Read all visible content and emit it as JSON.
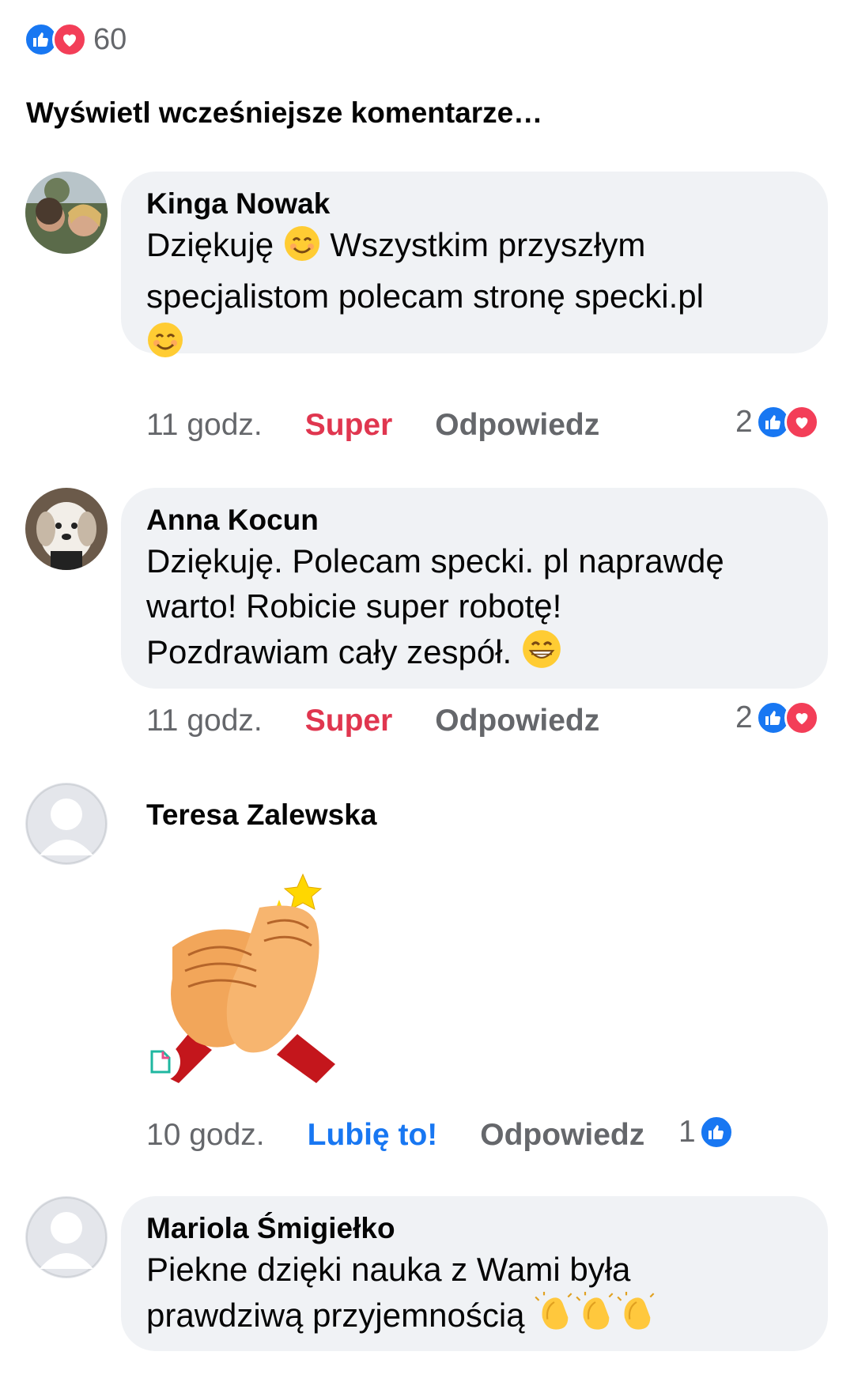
{
  "post": {
    "reaction_count": "60",
    "previous_comments_link": "Wyświetl wcześniejsze komentarze…"
  },
  "comments": [
    {
      "author": "Kinga Nowak",
      "text_lines": [
        "Dziękuję",
        " Wszystkim przyszłym",
        "specjalistom polecam stronę specki.pl"
      ],
      "time": "11 godz.",
      "reaction_label": "Super",
      "reply_label": "Odpowiedz",
      "reaction_count": "2",
      "reaction_icons": [
        "like-icon",
        "love-icon"
      ],
      "emojis": [
        "smiling-face-icon",
        "smiling-face-icon"
      ]
    },
    {
      "author": "Anna Kocun",
      "text_lines": [
        "Dziękuję. Polecam specki. pl naprawdę",
        "warto! Robicie super robotę!",
        "Pozdrawiam cały zespół."
      ],
      "time": "11 godz.",
      "reaction_label": "Super",
      "reply_label": "Odpowiedz",
      "reaction_count": "2",
      "reaction_icons": [
        "like-icon",
        "love-icon"
      ],
      "emojis": [
        "grinning-face-icon"
      ]
    },
    {
      "author": "Teresa Zalewska",
      "attachment": "clapping-hands-sticker",
      "time": "10 godz.",
      "reaction_label": "Lubię to!",
      "reply_label": "Odpowiedz",
      "reaction_count": "1",
      "reaction_icons": [
        "like-icon"
      ]
    },
    {
      "author": "Mariola Śmigiełko",
      "text_lines": [
        "Piekne dzięki nauka z Wami była",
        "prawdziwą przyjemnością"
      ],
      "emojis": [
        "clapping-hands-icon",
        "clapping-hands-icon",
        "clapping-hands-icon"
      ]
    }
  ],
  "colors": {
    "like_blue": "#1877f2",
    "love_red": "#f33e58",
    "super_label": "#e0364f",
    "bubble_bg": "#f0f2f5",
    "meta_gray": "#65676b"
  }
}
